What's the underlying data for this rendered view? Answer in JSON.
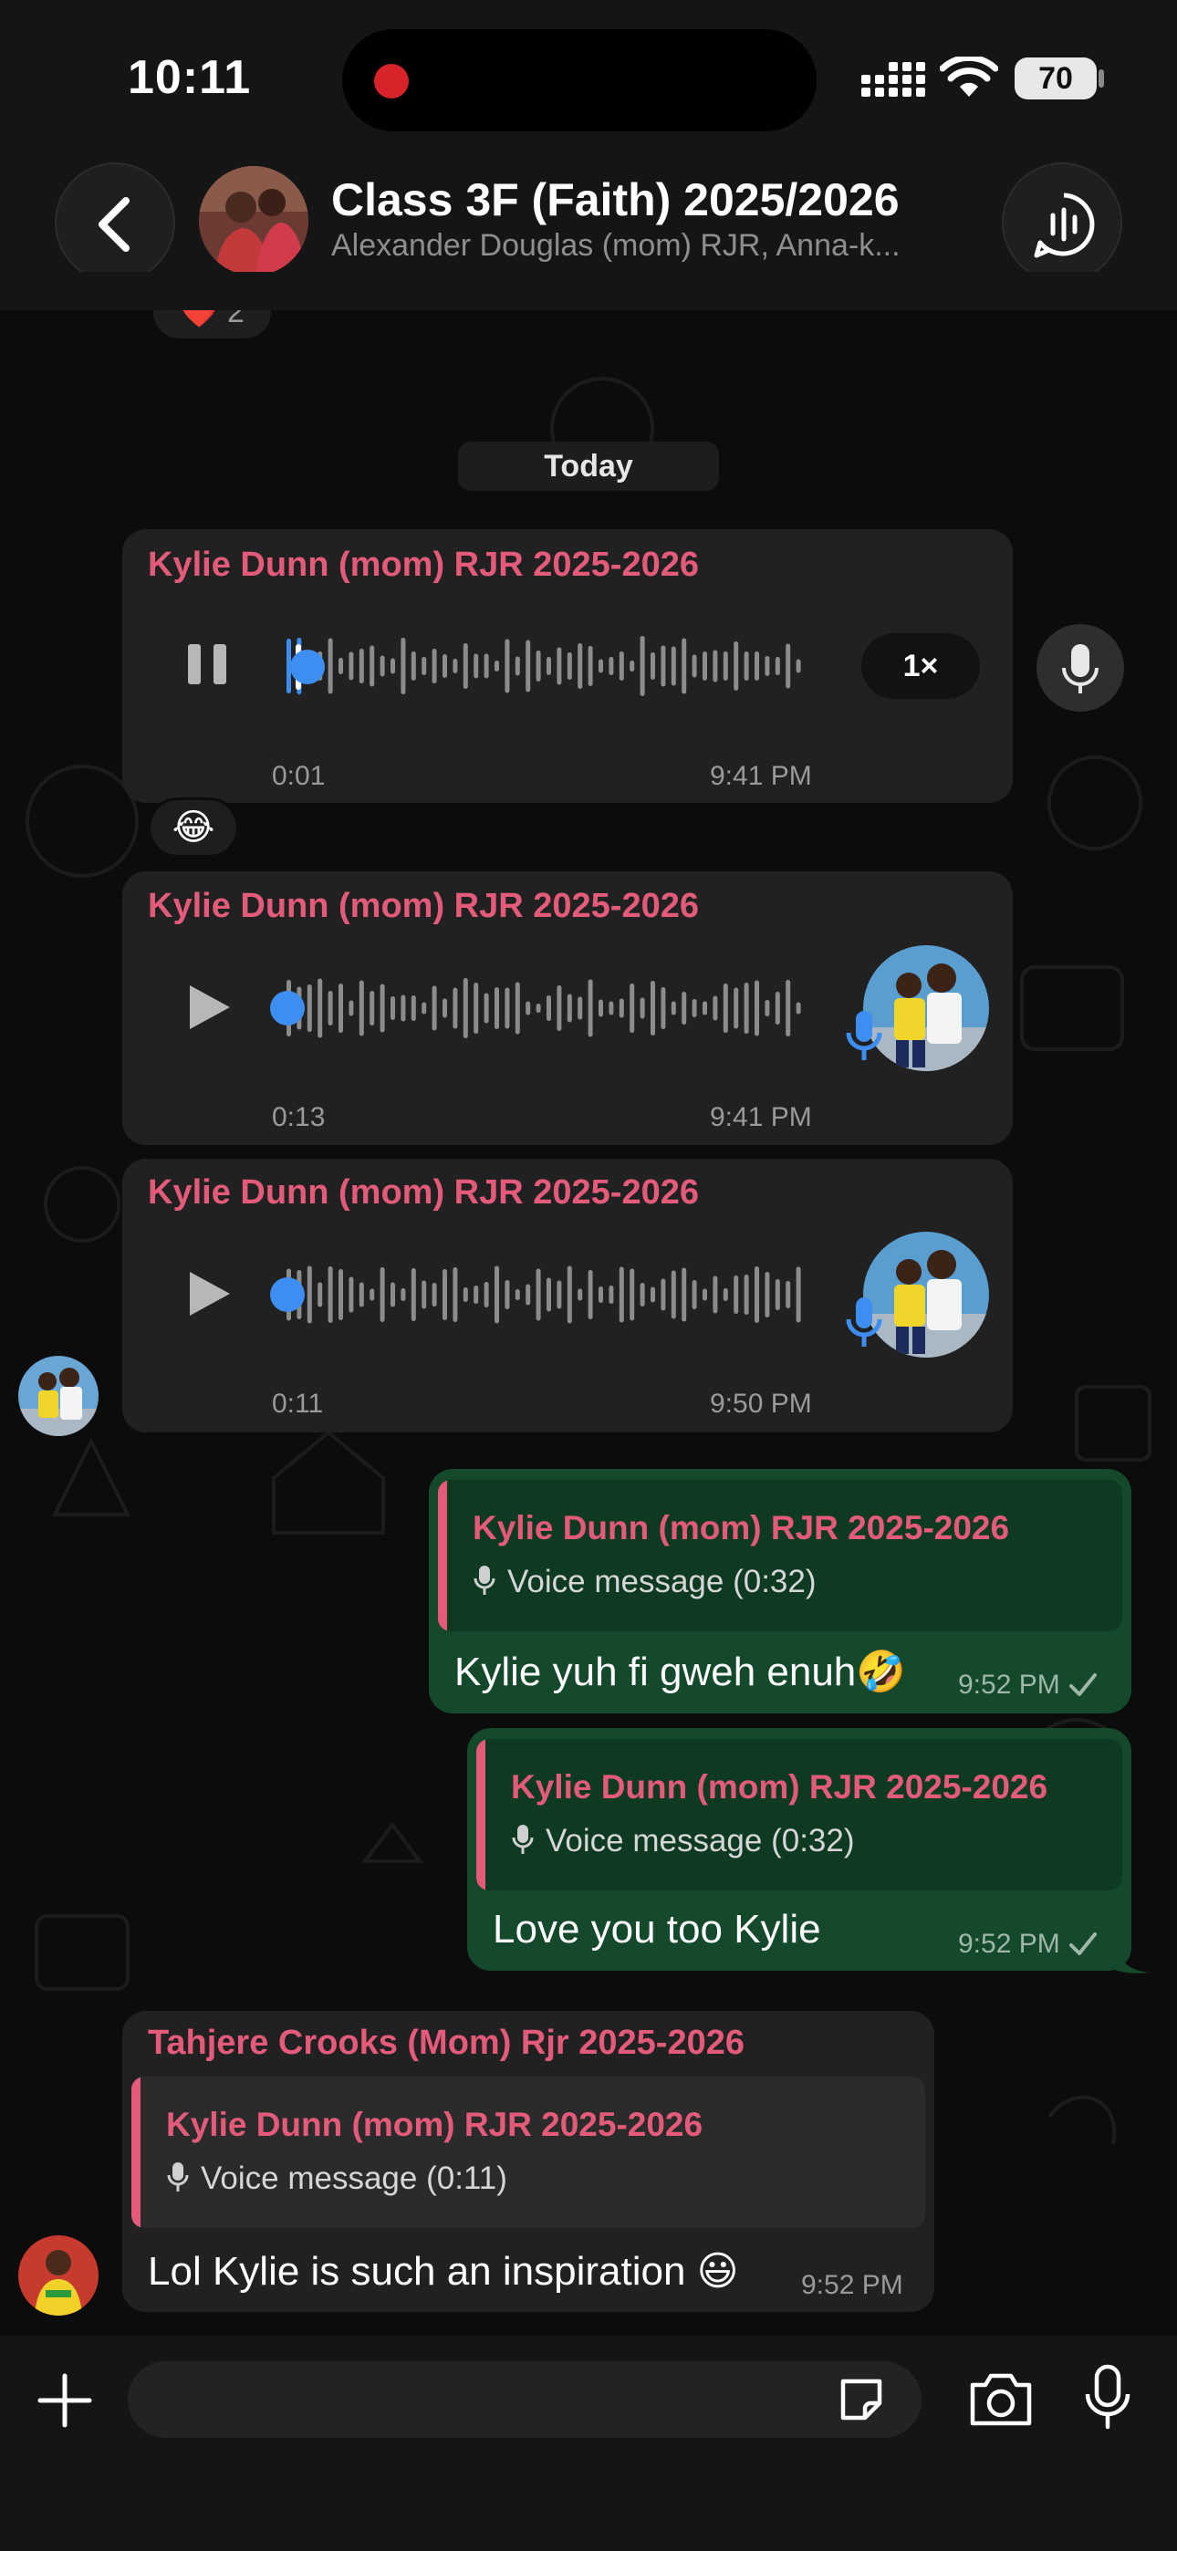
{
  "status_bar": {
    "time": "10:11",
    "battery": "70"
  },
  "header": {
    "title": "Class 3F (Faith) 2025/2026",
    "subtitle": "Alexander Douglas (mom) RJR, Anna-k..."
  },
  "colors": {
    "sender_name": "#e35b79",
    "outgoing_bubble": "#144a2b",
    "incoming_bubble": "#212121",
    "waveform_knob": "#3d8ef0"
  },
  "messages": {
    "prev_reaction": {
      "emoji": "❤️",
      "count": "2"
    },
    "date_label": "Today",
    "voice1": {
      "sender": "Kylie Dunn (mom) RJR 2025-2026",
      "duration": "0:01",
      "time": "9:41 PM",
      "speed": "1×",
      "reaction": "😂",
      "playing": true,
      "progress": 0.05
    },
    "voice2": {
      "sender": "Kylie Dunn (mom) RJR 2025-2026",
      "duration": "0:13",
      "time": "9:41 PM",
      "progress": 0
    },
    "voice3": {
      "sender": "Kylie Dunn (mom) RJR 2025-2026",
      "duration": "0:11",
      "time": "9:50 PM",
      "progress": 0
    },
    "out1": {
      "quote_sender": "Kylie Dunn (mom) RJR 2025-2026",
      "quote_text": "Voice message (0:32)",
      "text": "Kylie yuh fi gweh enuh🤣",
      "time": "9:52 PM",
      "status_icon": "check-icon"
    },
    "out2": {
      "quote_sender": "Kylie Dunn (mom) RJR 2025-2026",
      "quote_text": "Voice message (0:32)",
      "text": "Love you too Kylie",
      "time": "9:52 PM",
      "status_icon": "check-icon"
    },
    "in4": {
      "sender": "Tahjere Crooks (Mom) Rjr 2025-2026",
      "quote_sender": "Kylie Dunn (mom) RJR 2025-2026",
      "quote_text": "Voice message (0:11)",
      "text": "Lol Kylie is such an inspiration 😃",
      "time": "9:52 PM"
    }
  },
  "composer": {
    "placeholder": ""
  }
}
